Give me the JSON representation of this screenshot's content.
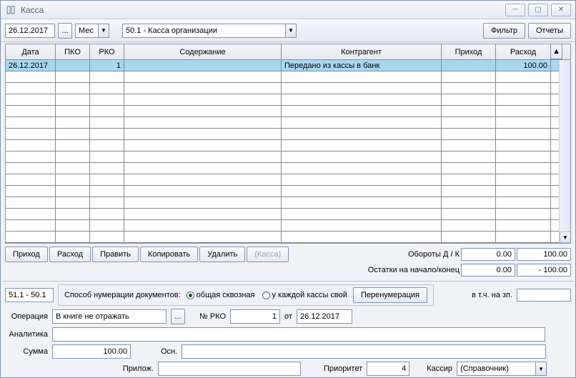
{
  "window": {
    "title": "Касса"
  },
  "toolbar": {
    "date": "26.12.2017",
    "period": "Мес",
    "account": "50.1 - Касса организации",
    "filter_btn": "Фильтр",
    "reports_btn": "Отчеты"
  },
  "grid": {
    "headers": {
      "date": "Дата",
      "pko": "ПКО",
      "rko": "РКО",
      "desc": "Содержание",
      "contr": "Контрагент",
      "in": "Приход",
      "out": "Расход"
    },
    "rows": [
      {
        "date": "26.12.2017",
        "pko": "",
        "rko": "1",
        "desc": "",
        "contr": "Передано из кассы в банк",
        "in": "",
        "out": "100.00"
      }
    ],
    "empty_rows": 15
  },
  "action_buttons": {
    "income": "Приход",
    "expense": "Расход",
    "edit": "Править",
    "copy": "Копировать",
    "delete": "Удалить",
    "kassa": "(Касса)"
  },
  "totals": {
    "turnover_label": "Обороты Д / К",
    "turnover_debit": "0.00",
    "turnover_credit": "100.00",
    "balance_label": "Остатки на начало/конец",
    "balance_start": "0.00",
    "balance_end": "- 100.00",
    "incl_salary_label": "в т.ч. на зп.",
    "incl_salary": ""
  },
  "detail": {
    "corr": "51.1 - 50.1",
    "numbering_label": "Способ нумерации документов:",
    "numbering_opt_common": "общая сквозная",
    "numbering_opt_each": "у каждой кассы свой",
    "renumber_btn": "Перенумерация",
    "op_label": "Операция",
    "op_value": "В книге не отражать",
    "docno_label": "№ РКО",
    "docno": "1",
    "docdate_label": "от",
    "docdate": "26.12.2017",
    "analytics_label": "Аналитика",
    "analytics": "",
    "sum_label": "Сумма",
    "sum": "100.00",
    "basis_label": "Осн.",
    "basis": "",
    "attach_label": "Прилож.",
    "attach": "",
    "priority_label": "Приоритет",
    "priority": "4",
    "cashier_label": "Кассир",
    "cashier": "(Справочник)"
  }
}
